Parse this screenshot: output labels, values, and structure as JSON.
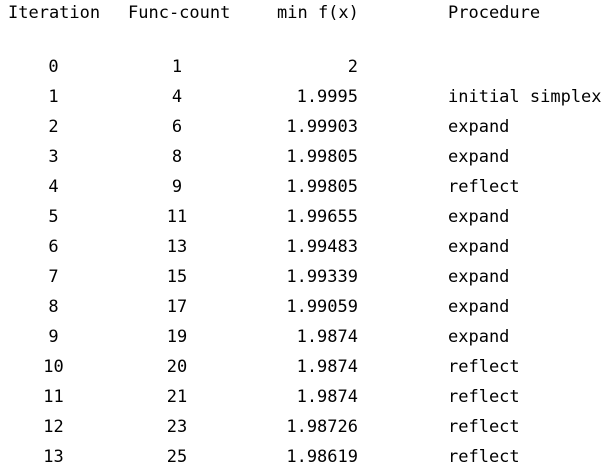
{
  "headers": {
    "iteration": "Iteration",
    "func_count": "Func-count",
    "min_fx": "min f(x)",
    "procedure": "Procedure"
  },
  "rows": [
    {
      "iteration": "0",
      "func_count": "1",
      "min_fx": "2",
      "procedure": ""
    },
    {
      "iteration": "1",
      "func_count": "4",
      "min_fx": "1.9995",
      "procedure": "initial simplex"
    },
    {
      "iteration": "2",
      "func_count": "6",
      "min_fx": "1.99903",
      "procedure": "expand"
    },
    {
      "iteration": "3",
      "func_count": "8",
      "min_fx": "1.99805",
      "procedure": "expand"
    },
    {
      "iteration": "4",
      "func_count": "9",
      "min_fx": "1.99805",
      "procedure": "reflect"
    },
    {
      "iteration": "5",
      "func_count": "11",
      "min_fx": "1.99655",
      "procedure": "expand"
    },
    {
      "iteration": "6",
      "func_count": "13",
      "min_fx": "1.99483",
      "procedure": "expand"
    },
    {
      "iteration": "7",
      "func_count": "15",
      "min_fx": "1.99339",
      "procedure": "expand"
    },
    {
      "iteration": "8",
      "func_count": "17",
      "min_fx": "1.99059",
      "procedure": "expand"
    },
    {
      "iteration": "9",
      "func_count": "19",
      "min_fx": "1.9874",
      "procedure": "expand"
    },
    {
      "iteration": "10",
      "func_count": "20",
      "min_fx": "1.9874",
      "procedure": "reflect"
    },
    {
      "iteration": "11",
      "func_count": "21",
      "min_fx": "1.9874",
      "procedure": "reflect"
    },
    {
      "iteration": "12",
      "func_count": "23",
      "min_fx": "1.98726",
      "procedure": "reflect"
    },
    {
      "iteration": "13",
      "func_count": "25",
      "min_fx": "1.98619",
      "procedure": "reflect"
    }
  ]
}
